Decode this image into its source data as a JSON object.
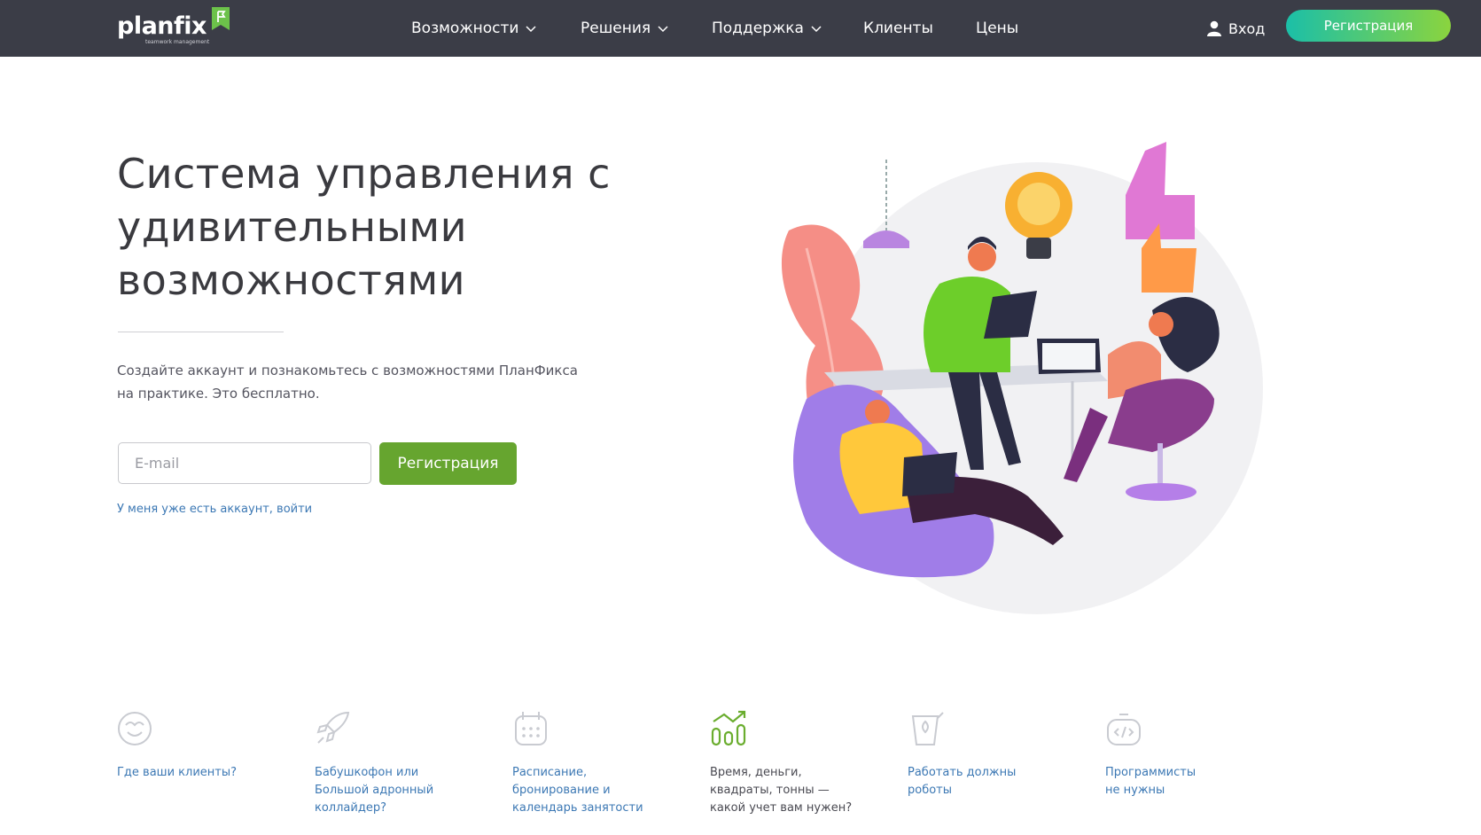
{
  "header": {
    "logo_text": "planfix",
    "logo_tagline": "teamwork management",
    "nav": [
      {
        "label": "Возможности",
        "has_dropdown": true
      },
      {
        "label": "Решения",
        "has_dropdown": true
      },
      {
        "label": "Поддержка",
        "has_dropdown": true
      },
      {
        "label": "Клиенты",
        "has_dropdown": false
      },
      {
        "label": "Цены",
        "has_dropdown": false
      }
    ],
    "login_label": "Вход",
    "register_label": "Регистрация"
  },
  "hero": {
    "title": "Система управления с удивительными возможностями",
    "subtitle_line1": "Создайте аккаунт и познакомьтесь с возможностями ПланФикса",
    "subtitle_line2": "на практике. Это бесплатно.",
    "email_placeholder": "E-mail",
    "register_label": "Регистрация",
    "login_link": "У меня уже есть аккаунт, войти"
  },
  "features": [
    {
      "icon": "smiley-icon",
      "label": "Где ваши клиенты?",
      "active": false
    },
    {
      "icon": "rocket-icon",
      "label": "Бабушкофон или\nБольшой адронный\nколлайдер?",
      "active": false
    },
    {
      "icon": "calendar-icon",
      "label": "Расписание,\nбронирование и\nкалендарь занятости",
      "active": false
    },
    {
      "icon": "growth-chart-icon",
      "label": "Время, деньги,\nквадраты, тонны —\nкакой учет вам нужен?",
      "active": true
    },
    {
      "icon": "robot-icon",
      "label": "Работать должны\nроботы",
      "active": false
    },
    {
      "icon": "code-icon",
      "label": "Программисты\nне нужны",
      "active": false
    }
  ],
  "colors": {
    "header_bg": "#3b3d47",
    "accent_green": "#66a52f",
    "link_blue": "#3c78b4",
    "gradient_start": "#1bbfa8",
    "gradient_end": "#8bd43e"
  }
}
